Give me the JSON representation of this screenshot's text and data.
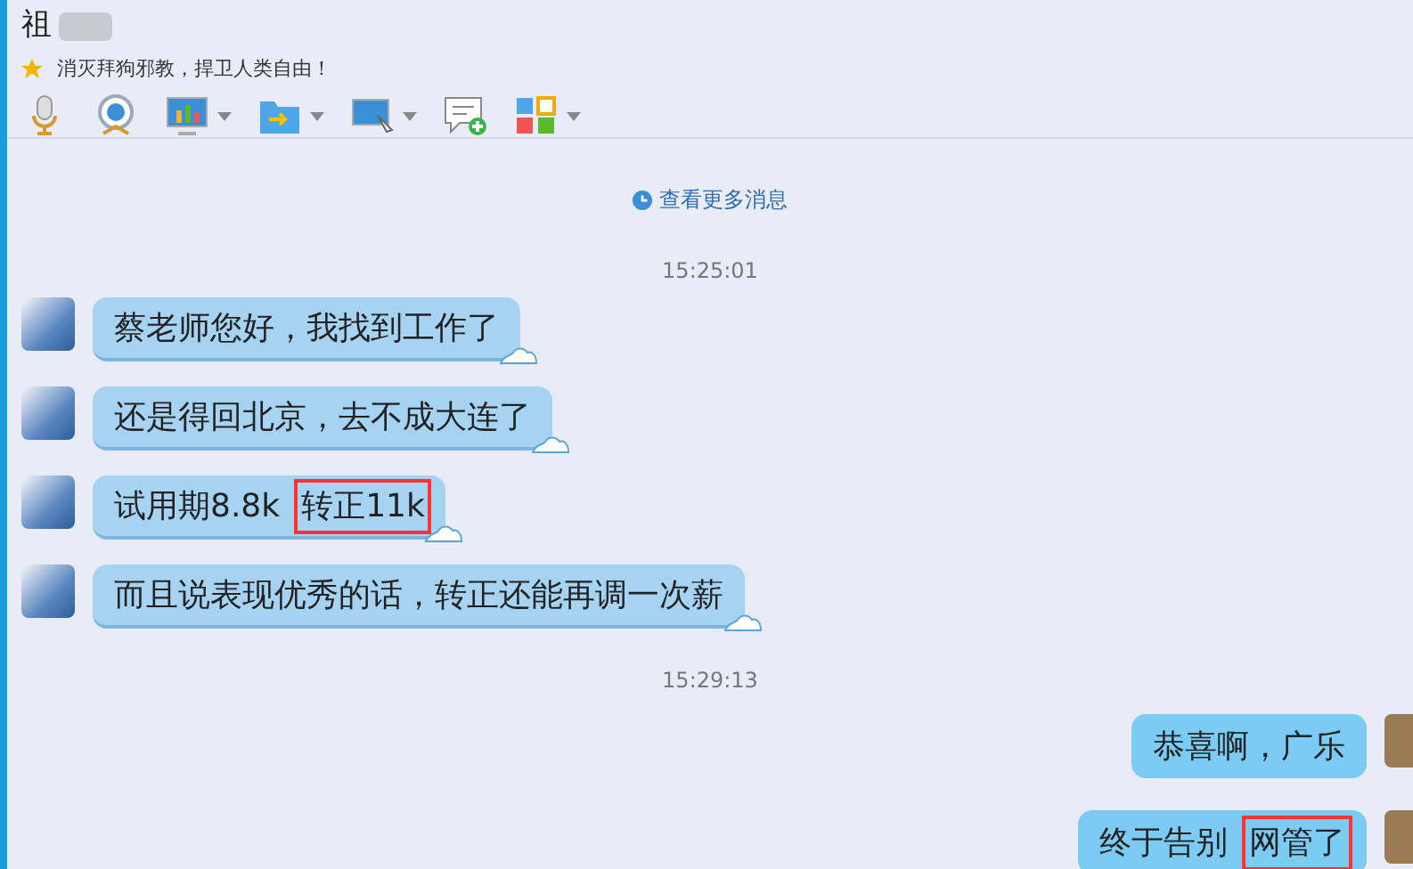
{
  "contact": {
    "name": "祖",
    "signature": "消灭拜狗邪教，捍卫人类自由！"
  },
  "history_link": "查看更多消息",
  "messages": [
    {
      "kind": "time",
      "text": "15:25:01"
    },
    {
      "kind": "incoming",
      "segments": [
        {
          "text": "蔡老师您好，我找到工作了",
          "marked": false
        }
      ]
    },
    {
      "kind": "incoming",
      "segments": [
        {
          "text": "还是得回北京，去不成大连了",
          "marked": false
        }
      ]
    },
    {
      "kind": "incoming",
      "segments": [
        {
          "text": "试用期8.8k",
          "marked": false
        },
        {
          "text": "转正11k",
          "marked": true
        }
      ]
    },
    {
      "kind": "incoming",
      "segments": [
        {
          "text": "而且说表现优秀的话，转正还能再调一次薪",
          "marked": false
        }
      ]
    },
    {
      "kind": "time",
      "text": "15:29:13"
    },
    {
      "kind": "outgoing",
      "segments": [
        {
          "text": "恭喜啊，广乐",
          "marked": false
        }
      ]
    },
    {
      "kind": "outgoing",
      "segments": [
        {
          "text": "终于告别",
          "marked": false
        },
        {
          "text": "网管了",
          "marked": true
        }
      ]
    }
  ]
}
